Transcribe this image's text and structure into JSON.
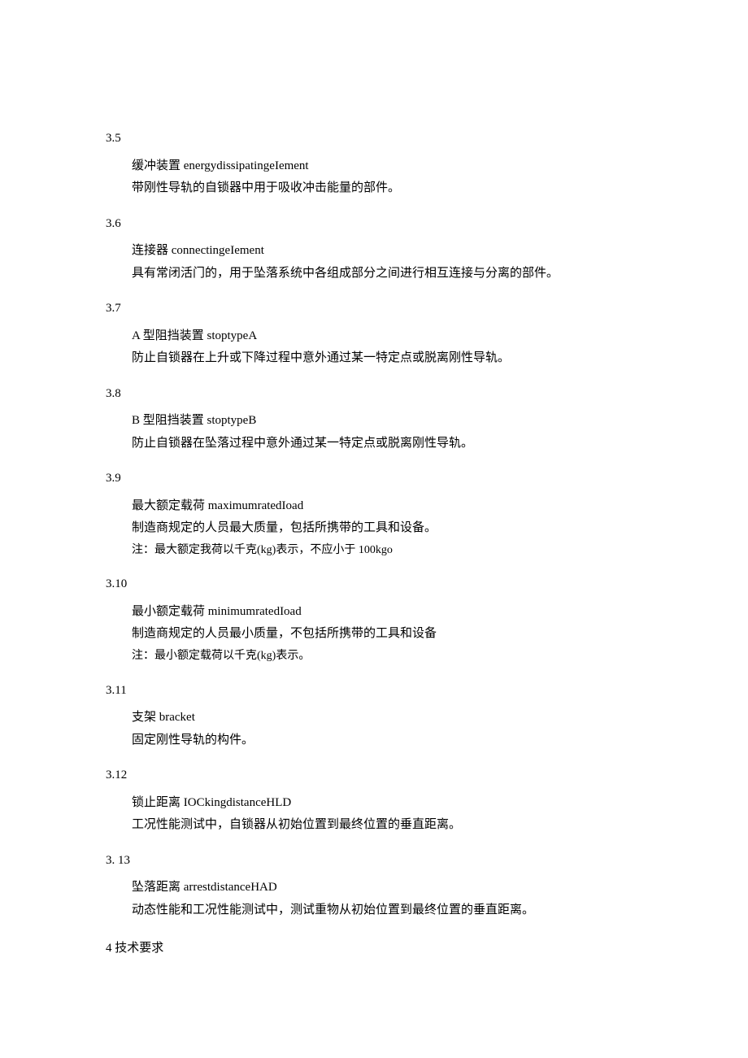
{
  "sections": [
    {
      "num": "3.5",
      "term": "缓冲装置 energydissipatingeIement",
      "def": "带刚性导轨的自锁器中用于吸收冲击能量的部件。"
    },
    {
      "num": "3.6",
      "term": "连接器 connectingeIement",
      "def": "具有常闭活门的，用于坠落系统中各组成部分之间进行相互连接与分离的部件。"
    },
    {
      "num": "3.7",
      "term": "A 型阻挡装置 stoptypeA",
      "def": "防止自锁器在上升或下降过程中意外通过某一特定点或脱离刚性导轨。"
    },
    {
      "num": "3.8",
      "term": "B 型阻挡装置 stoptypeB",
      "def": "防止自锁器在坠落过程中意外通过某一特定点或脱离刚性导轨。"
    },
    {
      "num": "3.9",
      "term": "最大额定载荷 maximumratedIoad",
      "def": "制造商规定的人员最大质量，包括所携带的工具和设备。",
      "note": "注：最大额定我荷以千克(kg)表示，不应小于 100kgo"
    },
    {
      "num": "3.10",
      "term": "最小额定载荷 minimumratedIoad",
      "def": "制造商规定的人员最小质量，不包括所携带的工具和设备",
      "note": "注：最小额定载荷以千克(kg)表示。"
    },
    {
      "num": "3.11",
      "term": "支架 bracket",
      "def": "固定刚性导轨的构件。"
    },
    {
      "num": "3.12",
      "term": "锁止距离 IOCkingdistanceHLD",
      "def": "工况性能测试中，自锁器从初始位置到最终位置的垂直距离。"
    },
    {
      "num": "3.   13",
      "term": "坠落距离 arrestdistanceHAD",
      "def": "动态性能和工况性能测试中，测试重物从初始位置到最终位置的垂直距离。"
    }
  ],
  "heading4": "4 技术要求"
}
